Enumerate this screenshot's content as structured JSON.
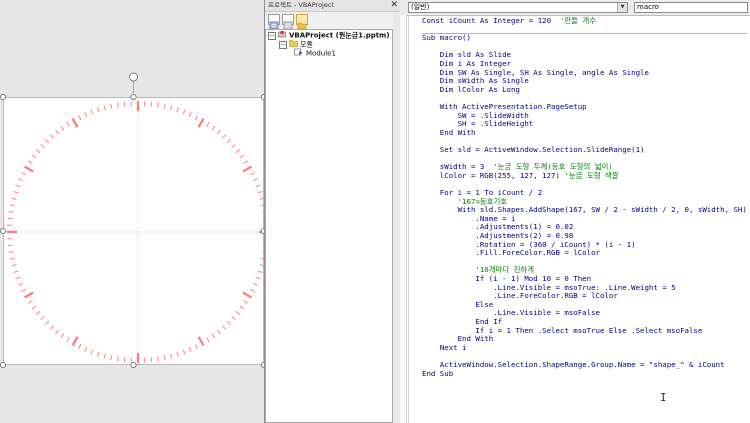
{
  "slide": {
    "tick_count": 120,
    "tick_color": "#ff7f7f",
    "major_every": 10
  },
  "project": {
    "title": "프로젝트 - VBAProject",
    "close_glyph": "✕",
    "tree": [
      {
        "text": "VBAProject (원눈금1.pptm)",
        "expander": "−",
        "icon": "project-icon",
        "level": 0
      },
      {
        "text": "모듈",
        "expander": "−",
        "icon": "folder-icon",
        "level": 1
      },
      {
        "text": "Module1",
        "expander": "",
        "icon": "module-icon",
        "level": 2
      }
    ]
  },
  "code": {
    "object_combo": "(일반)",
    "proc_combo": "macro",
    "colors": {
      "keyword": "#00008b",
      "comment": "#008000",
      "text": "#00008b"
    },
    "lines": [
      [
        {
          "t": "Const iCount As Integer = 120  ",
          "c": "k"
        },
        {
          "t": "'만들 개수",
          "c": "c"
        }
      ],
      [],
      [
        {
          "t": "Sub macro()",
          "c": "k"
        }
      ],
      [],
      [
        {
          "t": "    Dim sld As Slide",
          "c": "k"
        }
      ],
      [
        {
          "t": "    Dim i As Integer",
          "c": "k"
        }
      ],
      [
        {
          "t": "    Dim SW As Single, SH As Single, angle As Single",
          "c": "k"
        }
      ],
      [
        {
          "t": "    Dim sWidth As Single",
          "c": "k"
        }
      ],
      [
        {
          "t": "    Dim lColor As Long",
          "c": "k"
        }
      ],
      [],
      [
        {
          "t": "    With ActivePresentation.PageSetup",
          "c": "k"
        }
      ],
      [
        {
          "t": "        SW = .SlideWidth",
          "c": "k"
        }
      ],
      [
        {
          "t": "        SH = .SlideHeight",
          "c": "k"
        }
      ],
      [
        {
          "t": "    End With",
          "c": "k"
        }
      ],
      [],
      [
        {
          "t": "    Set sld = ActiveWindow.Selection.SlideRange(1)",
          "c": "k"
        }
      ],
      [],
      [
        {
          "t": "    sWidth = 3  ",
          "c": "k"
        },
        {
          "t": "'눈금 도형 두께(등호 도형의 넓이)",
          "c": "c"
        }
      ],
      [
        {
          "t": "    lColor = RGB(255, 127, 127) ",
          "c": "k"
        },
        {
          "t": "'눈금 도형 색깔",
          "c": "c"
        }
      ],
      [],
      [
        {
          "t": "    For i = 1 To iCount / 2",
          "c": "k"
        }
      ],
      [
        {
          "t": "        ",
          "c": "k"
        },
        {
          "t": "'167=등호기호",
          "c": "c"
        }
      ],
      [
        {
          "t": "        With sld.Shapes.AddShape(167, SW / 2 - sWidth / 2, 0, sWidth, SH)",
          "c": "k"
        }
      ],
      [
        {
          "t": "            .Name = i",
          "c": "k"
        }
      ],
      [
        {
          "t": "            .Adjustments(1) = 0.02",
          "c": "k"
        }
      ],
      [
        {
          "t": "            .Adjustments(2) = 0.98",
          "c": "k"
        }
      ],
      [
        {
          "t": "            .Rotation = (360 / iCount) * (i - 1)",
          "c": "k"
        }
      ],
      [
        {
          "t": "            .Fill.ForeColor.RGB = lColor",
          "c": "k"
        }
      ],
      [],
      [
        {
          "t": "            ",
          "c": "k"
        },
        {
          "t": "'10개마다 진하게",
          "c": "c"
        }
      ],
      [
        {
          "t": "            If (i - 1) Mod 10 = 0 Then",
          "c": "k"
        }
      ],
      [
        {
          "t": "                .Line.Visible = msoTrue: .Line.Weight = 5",
          "c": "k"
        }
      ],
      [
        {
          "t": "                .Line.ForeColor.RGB = lColor",
          "c": "k"
        }
      ],
      [
        {
          "t": "            Else",
          "c": "k"
        }
      ],
      [
        {
          "t": "                .Line.Visible = msoFalse",
          "c": "k"
        }
      ],
      [
        {
          "t": "            End If",
          "c": "k"
        }
      ],
      [
        {
          "t": "            If i = 1 Then .Select msoTrue Else .Select msoFalse",
          "c": "k"
        }
      ],
      [
        {
          "t": "        End With",
          "c": "k"
        }
      ],
      [
        {
          "t": "    Next i",
          "c": "k"
        }
      ],
      [],
      [
        {
          "t": "    ActiveWindow.Selection.ShapeRange.Group.Name = \"shape_\" & iCount",
          "c": "k"
        }
      ],
      [
        {
          "t": "End Sub",
          "c": "k"
        }
      ]
    ],
    "ibeam": "I"
  }
}
